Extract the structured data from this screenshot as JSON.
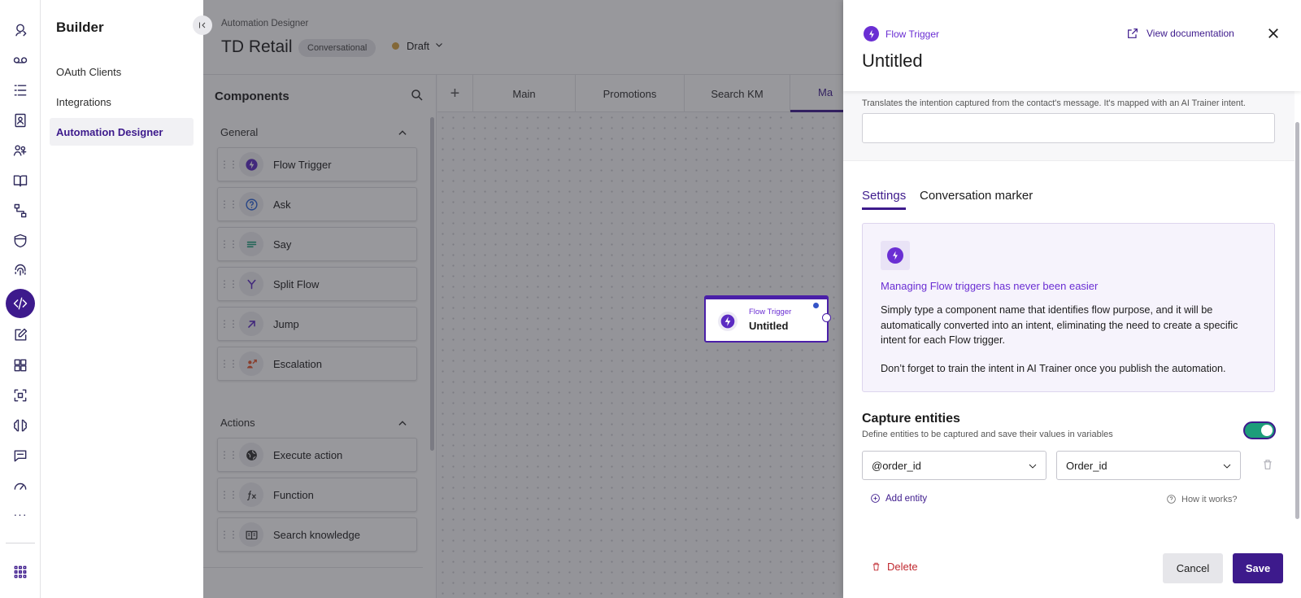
{
  "builder": {
    "title": "Builder",
    "items": [
      {
        "label": "OAuth Clients"
      },
      {
        "label": "Integrations"
      },
      {
        "label": "Automation Designer",
        "active": true
      }
    ]
  },
  "header": {
    "breadcrumb": "Automation Designer",
    "title": "TD Retail",
    "type_chip": "Conversational",
    "status": "Draft",
    "status_color": "#d6a340"
  },
  "components": {
    "title": "Components",
    "sections": [
      {
        "title": "General",
        "items": [
          {
            "label": "Flow Trigger",
            "icon": "bolt-icon"
          },
          {
            "label": "Ask",
            "icon": "question-icon"
          },
          {
            "label": "Say",
            "icon": "lines-icon"
          },
          {
            "label": "Split Flow",
            "icon": "split-icon"
          },
          {
            "label": "Jump",
            "icon": "arrow-up-right-icon"
          },
          {
            "label": "Escalation",
            "icon": "escalation-icon"
          }
        ]
      },
      {
        "title": "Actions",
        "items": [
          {
            "label": "Execute action",
            "icon": "globe-icon"
          },
          {
            "label": "Function",
            "icon": "fx-icon"
          },
          {
            "label": "Search knowledge",
            "icon": "book-icon"
          }
        ]
      }
    ]
  },
  "tabs": {
    "add_label": "+",
    "items": [
      {
        "label": "Main"
      },
      {
        "label": "Promotions"
      },
      {
        "label": "Search KM"
      },
      {
        "label": "Ma",
        "active": true
      }
    ]
  },
  "node": {
    "type_label": "Flow Trigger",
    "title": "Untitled"
  },
  "drawer": {
    "type_label": "Flow Trigger",
    "title": "Untitled",
    "doc_link": "View documentation",
    "intent_hint": "Translates the intention captured from the contact's message. It's mapped with an AI Trainer intent.",
    "intent_value": "",
    "tabs": [
      {
        "label": "Settings",
        "active": true
      },
      {
        "label": "Conversation marker"
      }
    ],
    "info": {
      "heading": "Managing Flow triggers has never been easier",
      "p1": "Simply type a component name that identifies flow purpose, and it will be automatically converted into an intent, eliminating the need to create a specific intent for each Flow trigger.",
      "p2": "Don’t forget to train the intent in AI Trainer once you publish the automation."
    },
    "capture": {
      "title": "Capture entities",
      "description": "Define entities to be captured and save their values in variables",
      "enabled": true,
      "entity_value": "@order_id",
      "variable_value": "Order_id",
      "add_label": "Add entity",
      "help_label": "How it works?"
    },
    "footer": {
      "delete_label": "Delete",
      "cancel_label": "Cancel",
      "save_label": "Save"
    }
  },
  "colors": {
    "accent": "#3d1a8c",
    "brand_purple": "#6a2ed3",
    "toggle_on": "#1d9d7a",
    "danger": "#c0282f"
  }
}
